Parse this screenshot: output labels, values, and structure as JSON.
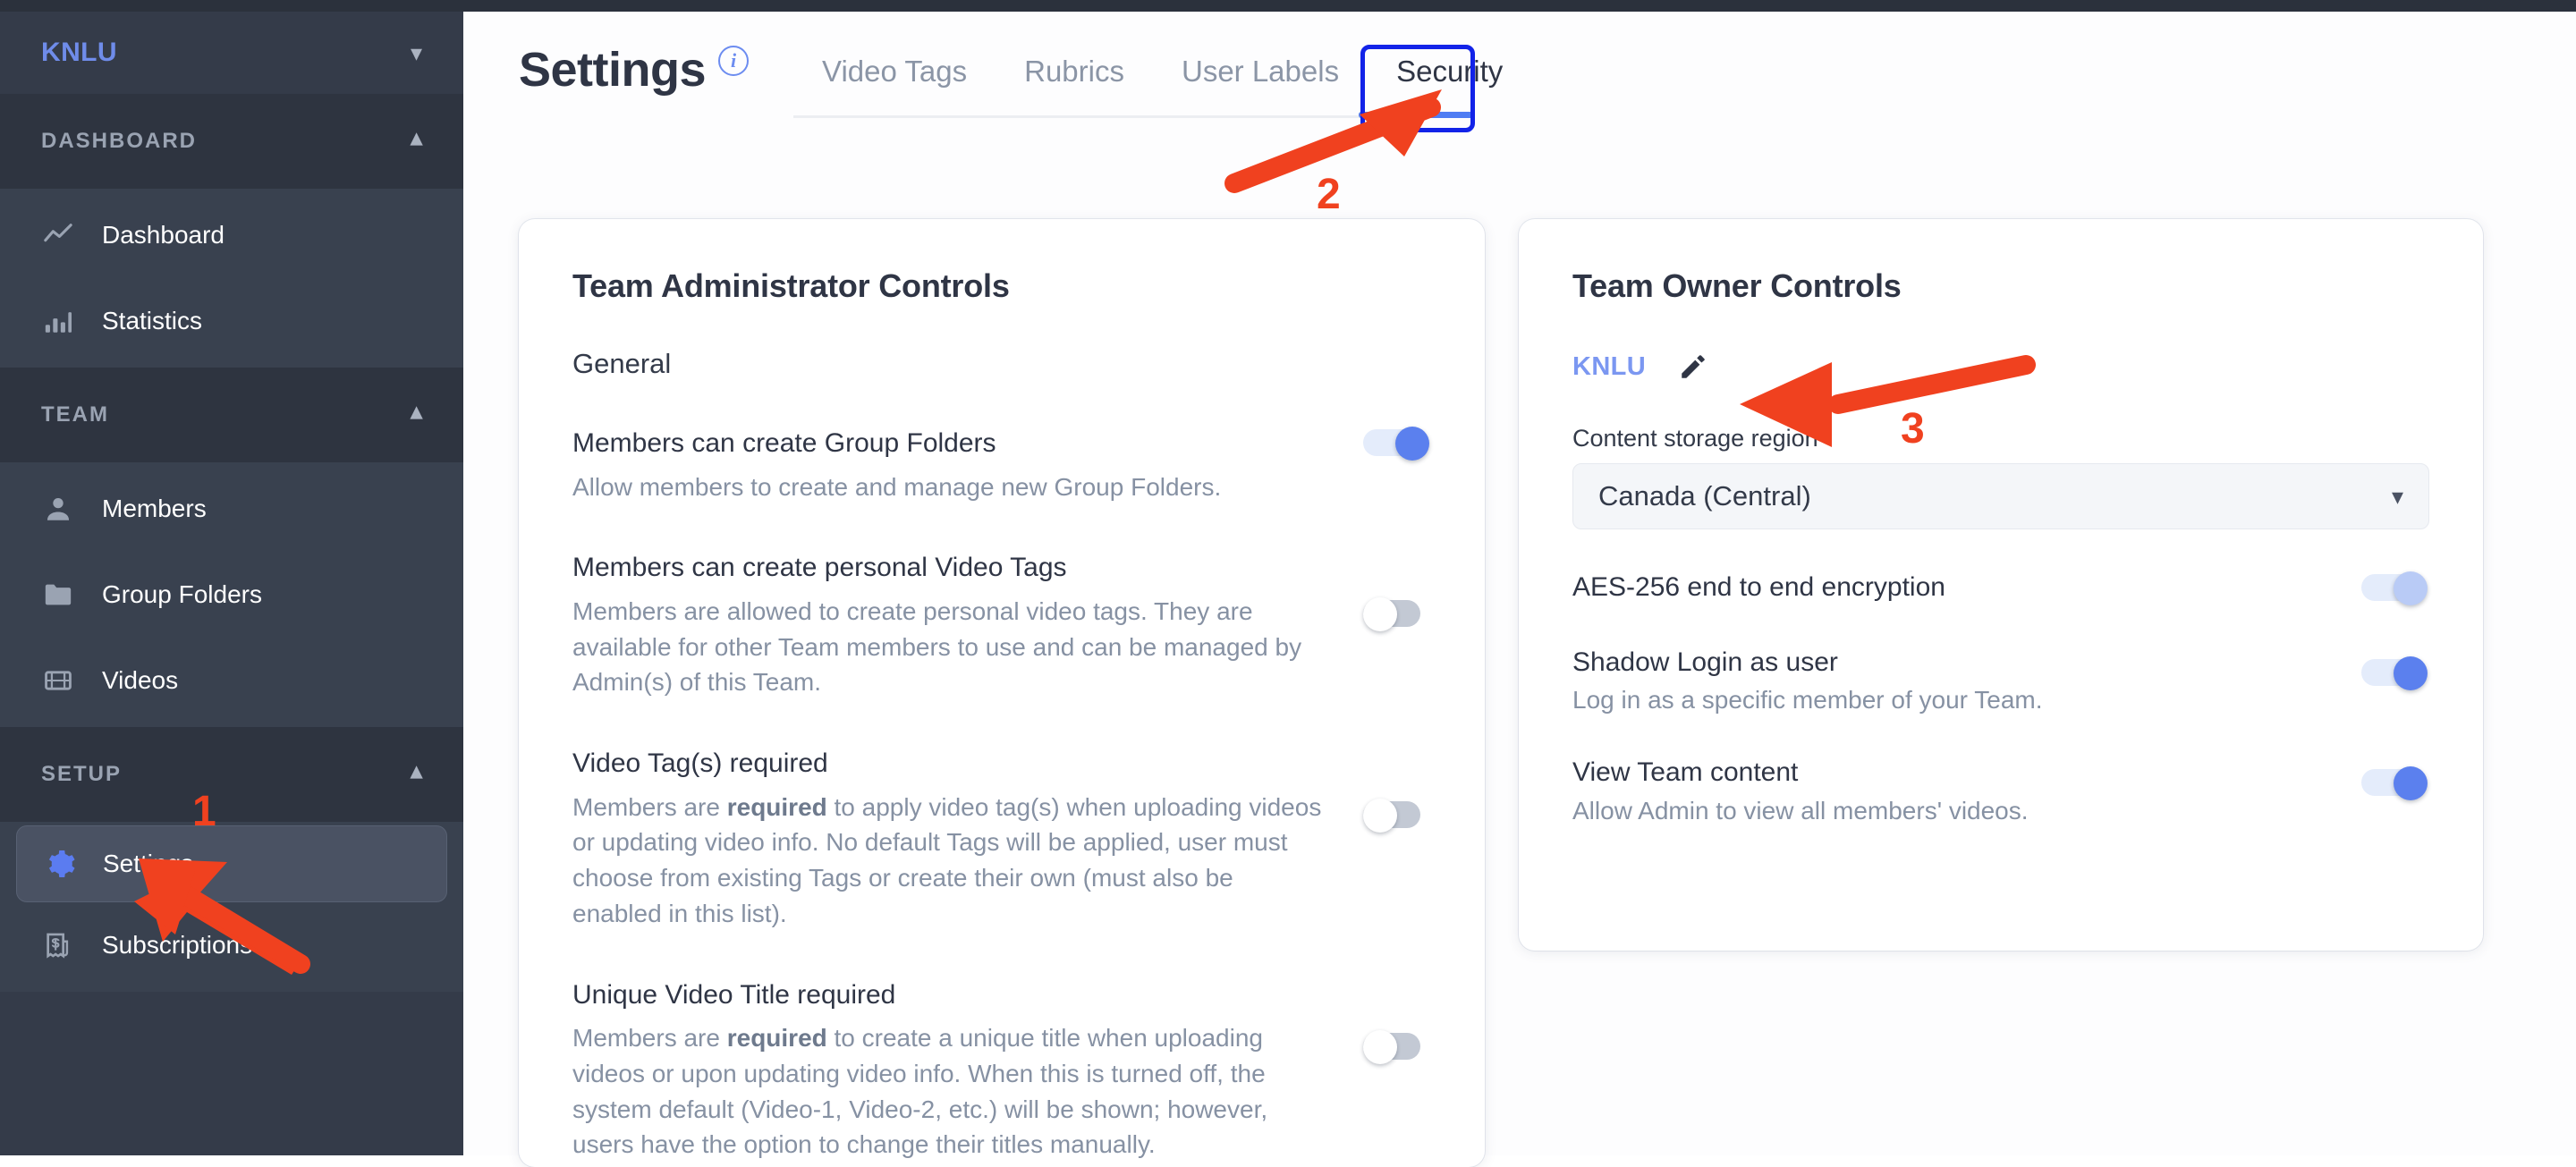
{
  "sidebar": {
    "team": {
      "name": "KNLU",
      "chevron": "chevron-down-icon"
    },
    "groups": [
      {
        "label": "DASHBOARD",
        "chevron": "chevron-up-icon",
        "items": [
          {
            "label": "Dashboard",
            "icon": "line-chart-icon",
            "active": false
          },
          {
            "label": "Statistics",
            "icon": "bar-chart-icon",
            "active": false
          }
        ]
      },
      {
        "label": "TEAM",
        "chevron": "chevron-up-icon",
        "items": [
          {
            "label": "Members",
            "icon": "person-icon",
            "active": false
          },
          {
            "label": "Group Folders",
            "icon": "folder-icon",
            "active": false
          },
          {
            "label": "Videos",
            "icon": "film-icon",
            "active": false
          }
        ]
      },
      {
        "label": "SETUP",
        "chevron": "chevron-up-icon",
        "items": [
          {
            "label": "Settings",
            "icon": "gear-icon",
            "active": true
          },
          {
            "label": "Subscriptions",
            "icon": "receipt-dollar-icon",
            "active": false
          }
        ]
      }
    ]
  },
  "header": {
    "title": "Settings",
    "info_icon": "info-circle-icon",
    "tabs": [
      {
        "label": "Video Tags",
        "active": false
      },
      {
        "label": "Rubrics",
        "active": false
      },
      {
        "label": "User Labels",
        "active": false
      },
      {
        "label": "Security",
        "active": true
      }
    ]
  },
  "admin_card": {
    "title": "Team Administrator Controls",
    "section": "General",
    "settings": [
      {
        "name": "Members can create Group Folders",
        "desc_pre": "Allow members to create and manage new Group Folders.",
        "desc_bold": "",
        "desc_post": "",
        "state": "on"
      },
      {
        "name": "Members can create personal Video Tags",
        "desc_pre": "Members are allowed to create personal video tags. They are available for other Team members to use and can be managed by Admin(s) of this Team.",
        "desc_bold": "",
        "desc_post": "",
        "state": "off"
      },
      {
        "name": "Video Tag(s) required",
        "desc_pre": "Members are ",
        "desc_bold": "required",
        "desc_post": " to apply video tag(s) when uploading videos or updating video info. No default Tags will be applied, user must choose from existing Tags or create their own (must also be enabled in this list).",
        "state": "off"
      },
      {
        "name": "Unique Video Title required",
        "desc_pre": "Members are ",
        "desc_bold": "required",
        "desc_post": " to create a unique title when uploading videos or upon updating video info. When this is turned off, the system default (Video-1, Video-2, etc.) will be shown; however, users have the option to change their titles manually.",
        "state": "off"
      }
    ]
  },
  "owner_card": {
    "title": "Team Owner Controls",
    "team_name": "KNLU",
    "edit_icon": "pencil-icon",
    "storage_label": "Content storage region",
    "storage_value": "Canada (Central)",
    "storage_chevron": "chevron-down-icon",
    "settings": [
      {
        "name": "AES-256 end to end encryption",
        "desc": "",
        "state": "on-disabled"
      },
      {
        "name": "Shadow Login as user",
        "desc": "Log in as a specific member of your Team.",
        "state": "on"
      },
      {
        "name": "View Team content",
        "desc": "Allow Admin to view all members' videos.",
        "state": "on"
      }
    ]
  },
  "annotations": {
    "color": "#f0411f",
    "steps": [
      {
        "number": "1",
        "target": "sidebar-item-settings"
      },
      {
        "number": "2",
        "target": "tab-security"
      },
      {
        "number": "3",
        "target": "owner-team-edit-pencil"
      }
    ]
  },
  "colors": {
    "accent_blue": "#5b80ee",
    "sidebar_bg": "#343b49",
    "annotation_red": "#f0411f",
    "highlight_box": "#1223e8"
  }
}
